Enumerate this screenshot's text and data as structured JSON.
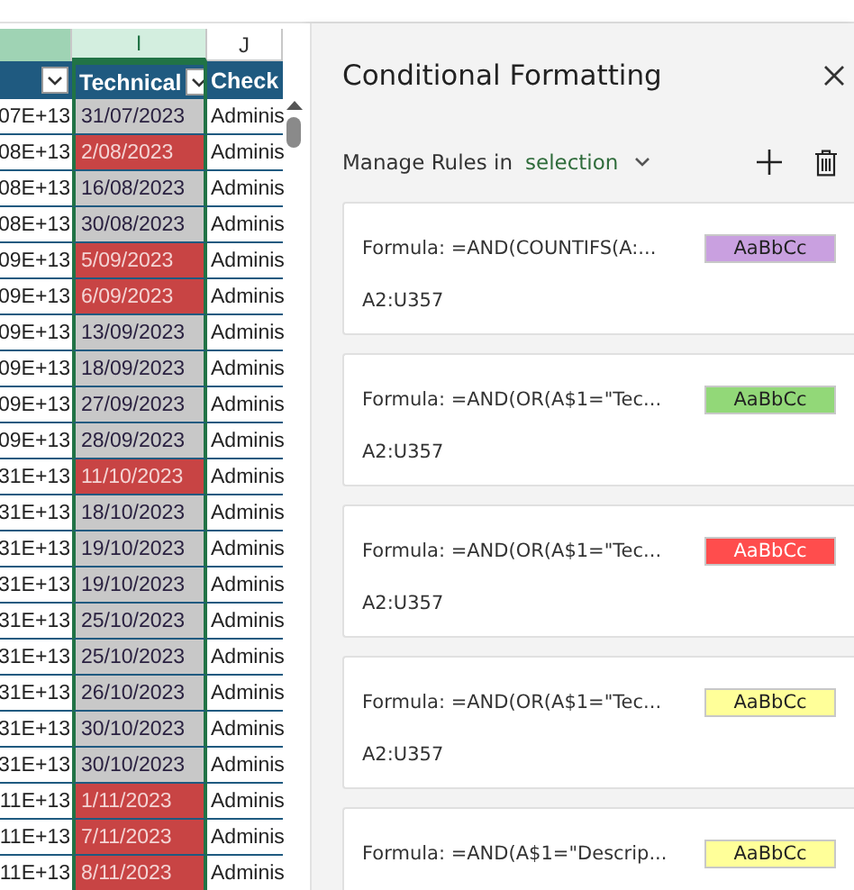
{
  "sheet": {
    "column_letters": [
      {
        "selected": false
      },
      {
        "label": "I",
        "selected": true
      },
      {
        "label": "J",
        "selected": false
      }
    ],
    "headers": [
      {
        "filter": true
      },
      {
        "label": "Technical",
        "filter": true
      },
      {
        "label": "Check",
        "filter": false
      }
    ],
    "rows": [
      {
        "column_1": "07E+13",
        "date": "31/07/2023",
        "highlighted": false,
        "column_3": "Adminis"
      },
      {
        "column_1": "08E+13",
        "date": "2/08/2023",
        "highlighted": true,
        "column_3": "Adminis"
      },
      {
        "column_1": "08E+13",
        "date": "16/08/2023",
        "highlighted": false,
        "column_3": "Adminis"
      },
      {
        "column_1": "08E+13",
        "date": "30/08/2023",
        "highlighted": false,
        "column_3": "Adminis"
      },
      {
        "column_1": "09E+13",
        "date": "5/09/2023",
        "highlighted": true,
        "column_3": "Adminis"
      },
      {
        "column_1": "09E+13",
        "date": "6/09/2023",
        "highlighted": true,
        "column_3": "Adminis"
      },
      {
        "column_1": "09E+13",
        "date": "13/09/2023",
        "highlighted": false,
        "column_3": "Adminis"
      },
      {
        "column_1": "09E+13",
        "date": "18/09/2023",
        "highlighted": false,
        "column_3": "Adminis"
      },
      {
        "column_1": "09E+13",
        "date": "27/09/2023",
        "highlighted": false,
        "column_3": "Adminis"
      },
      {
        "column_1": "09E+13",
        "date": "28/09/2023",
        "highlighted": false,
        "column_3": "Adminis"
      },
      {
        "column_1": "31E+13",
        "date": "11/10/2023",
        "highlighted": true,
        "column_3": "Adminis"
      },
      {
        "column_1": "31E+13",
        "date": "18/10/2023",
        "highlighted": false,
        "column_3": "Adminis"
      },
      {
        "column_1": "31E+13",
        "date": "19/10/2023",
        "highlighted": false,
        "column_3": "Adminis"
      },
      {
        "column_1": "31E+13",
        "date": "19/10/2023",
        "highlighted": false,
        "column_3": "Adminis"
      },
      {
        "column_1": "31E+13",
        "date": "25/10/2023",
        "highlighted": false,
        "column_3": "Adminis"
      },
      {
        "column_1": "31E+13",
        "date": "25/10/2023",
        "highlighted": false,
        "column_3": "Adminis"
      },
      {
        "column_1": "31E+13",
        "date": "26/10/2023",
        "highlighted": false,
        "column_3": "Adminis"
      },
      {
        "column_1": "31E+13",
        "date": "30/10/2023",
        "highlighted": false,
        "column_3": "Adminis"
      },
      {
        "column_1": "31E+13",
        "date": "30/10/2023",
        "highlighted": false,
        "column_3": "Adminis"
      },
      {
        "column_1": "11E+13",
        "date": "1/11/2023",
        "highlighted": true,
        "column_3": "Adminis"
      },
      {
        "column_1": "11E+13",
        "date": "7/11/2023",
        "highlighted": true,
        "column_3": "Adminis"
      },
      {
        "column_1": "11E+13",
        "date": "8/11/2023",
        "highlighted": true,
        "column_3": "Adminis"
      }
    ]
  },
  "panel": {
    "title": "Conditional Formatting",
    "manage_label": "Manage Rules in",
    "scope": "selection",
    "rules": [
      {
        "formula": "Formula: =AND(COUNTIFS(A:...",
        "preview": "AaBbCc",
        "color": "#c9a0e0",
        "range": "A2:U357"
      },
      {
        "formula": "Formula: =AND(OR(A$1=\"Tec...",
        "preview": "AaBbCc",
        "color": "#92d878",
        "range": "A2:U357"
      },
      {
        "formula": "Formula: =AND(OR(A$1=\"Tec...",
        "preview": "AaBbCc",
        "color": "#ff4d4d",
        "range": "A2:U357"
      },
      {
        "formula": "Formula: =AND(OR(A$1=\"Tec...",
        "preview": "AaBbCc",
        "color": "#ffff99",
        "range": "A2:U357"
      },
      {
        "formula": "Formula: =AND(A$1=\"Descrip...",
        "preview": "AaBbCc",
        "color": "#ffff99"
      }
    ]
  }
}
